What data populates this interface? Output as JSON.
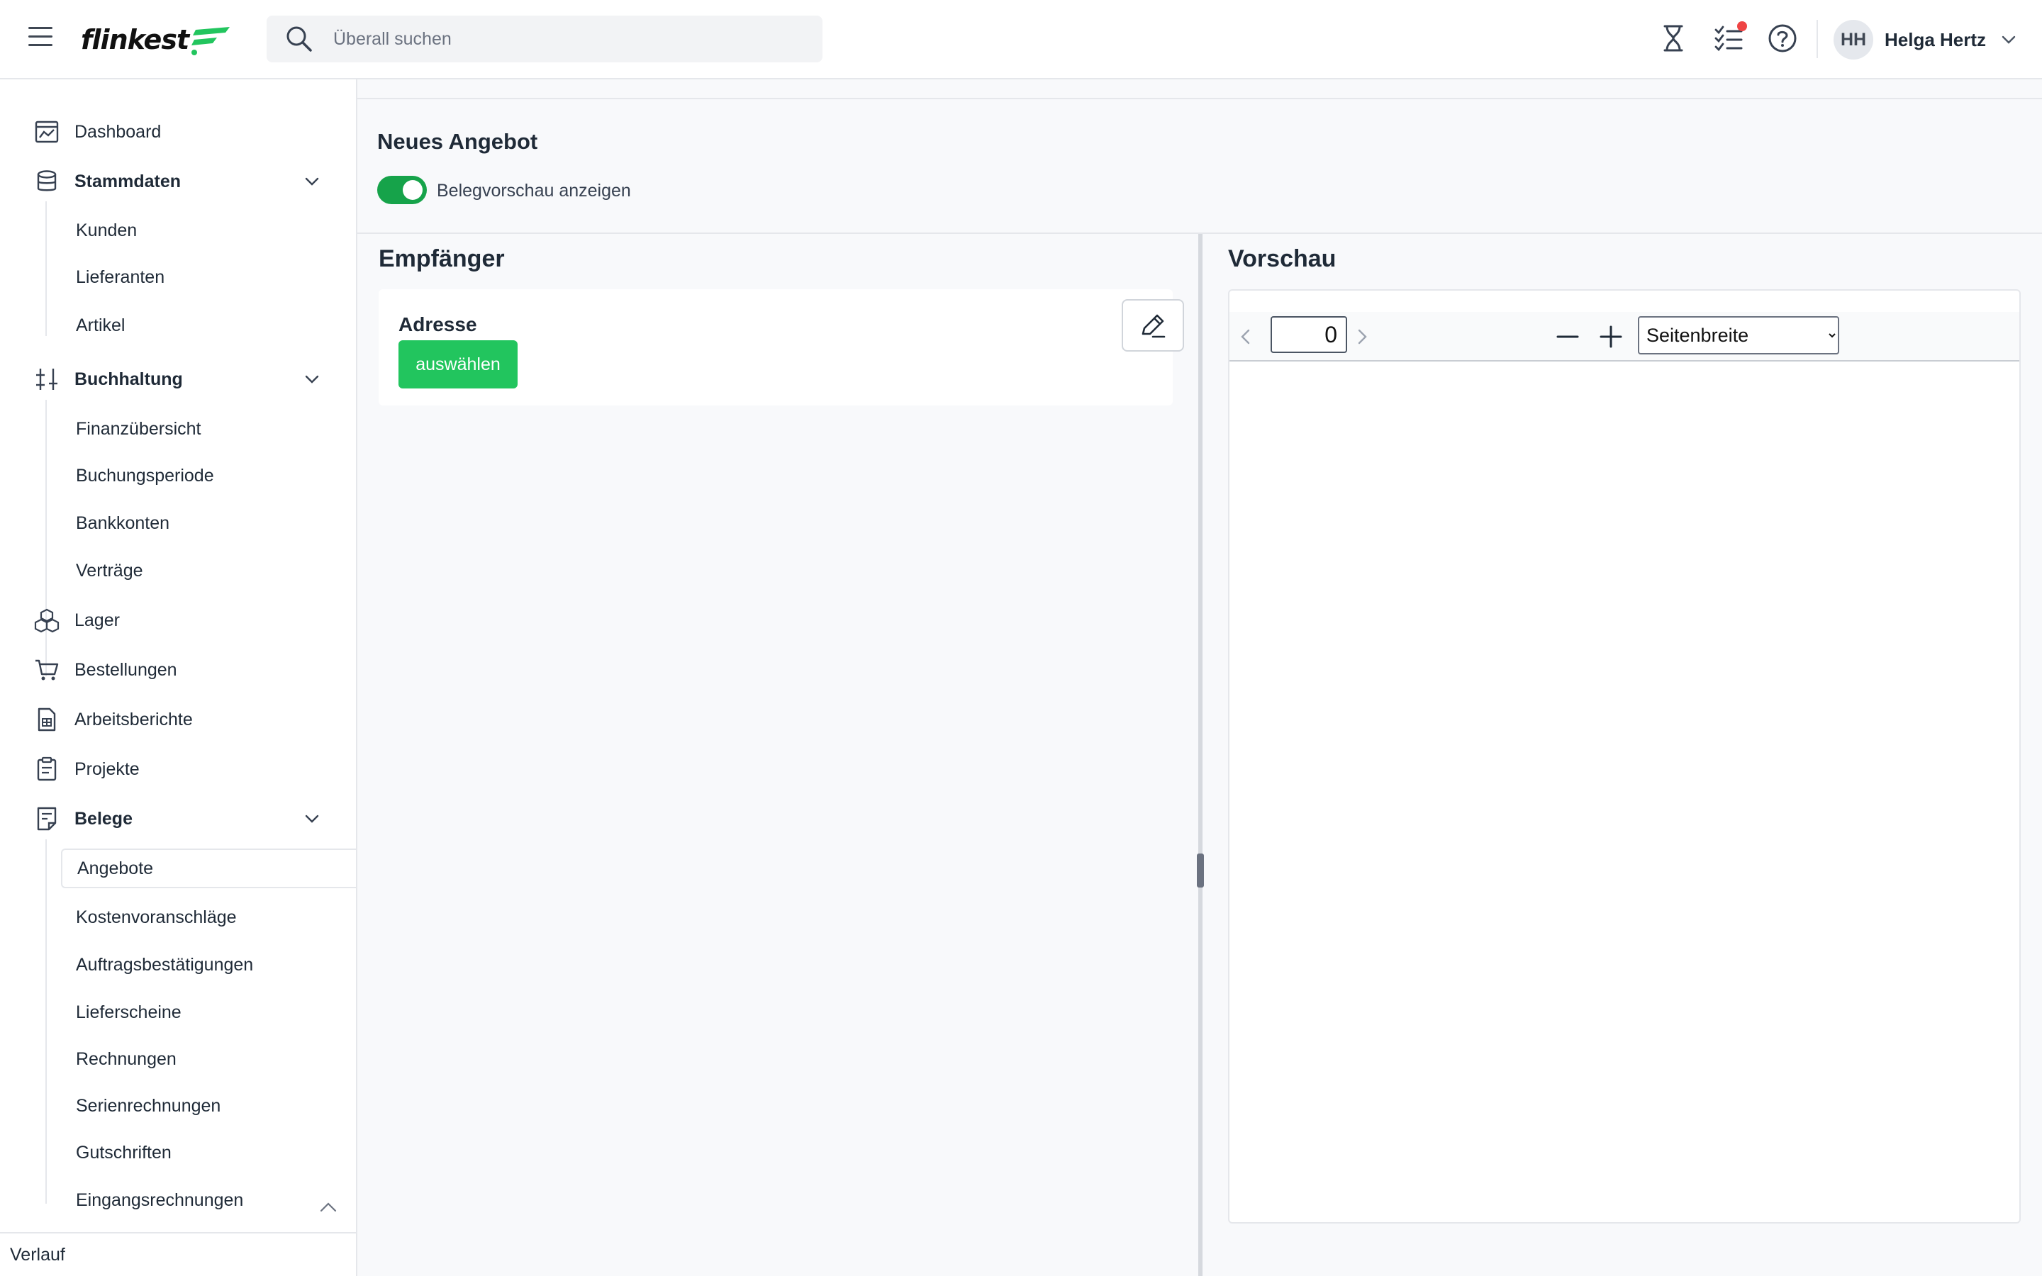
{
  "app": {
    "logo_text": "flinkest",
    "brand_color": "#22c55e"
  },
  "search": {
    "placeholder": "Überall suchen",
    "icon": "search-icon"
  },
  "header": {
    "icons": [
      "hourglass-icon",
      "task-checklist-icon",
      "help-icon"
    ],
    "notification_badge_color": "#ef4444",
    "user": {
      "initials": "HH",
      "name": "Helga Hertz"
    }
  },
  "sidebar": {
    "items": [
      {
        "label": "Dashboard",
        "icon": "dashboard-icon"
      },
      {
        "label": "Stammdaten",
        "icon": "database-icon",
        "expanded": true,
        "children": [
          "Kunden",
          "Lieferanten",
          "Artikel"
        ]
      },
      {
        "label": "Buchhaltung",
        "icon": "sliders-icon",
        "expanded": true,
        "children": [
          "Finanzübersicht",
          "Buchungsperiode",
          "Bankkonten",
          "Verträge"
        ]
      },
      {
        "label": "Lager",
        "icon": "boxes-icon"
      },
      {
        "label": "Bestellungen",
        "icon": "cart-icon"
      },
      {
        "label": "Arbeitsberichte",
        "icon": "report-icon"
      },
      {
        "label": "Projekte",
        "icon": "clipboard-icon"
      },
      {
        "label": "Belege",
        "icon": "document-icon",
        "expanded": true,
        "children": [
          "Angebote",
          "Kostenvoranschläge",
          "Auftragsbestätigungen",
          "Lieferscheine",
          "Rechnungen",
          "Serienrechnungen",
          "Gutschriften",
          "Eingangsrechnungen"
        ],
        "active_child": "Angebote"
      }
    ],
    "bottom_label": "Verlauf"
  },
  "main": {
    "page_title": "Neues Angebot",
    "toggle": {
      "label": "Belegvorschau anzeigen",
      "checked": true
    },
    "recipient": {
      "title": "Empfänger",
      "address_label": "Adresse",
      "select_button": "auswählen"
    },
    "preview": {
      "title": "Vorschau",
      "page_number": "0",
      "zoom_options": [
        "Seitenbreite"
      ],
      "zoom_selected": "Seitenbreite"
    }
  }
}
